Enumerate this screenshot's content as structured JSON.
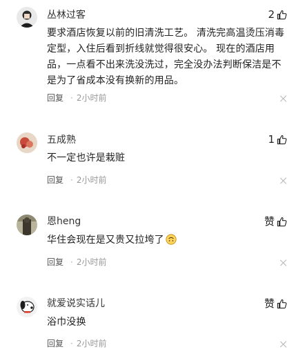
{
  "comments": [
    {
      "username": "丛林过客",
      "likes": "2",
      "text": "要求酒店恢复以前的旧清洗工艺。 清洗完高温烫压消毒定型，入住后看到折线就觉得很安心。 现在的酒店用品，一点看不出来洗没洗过，完全没办法判断保洁是不是为了省成本没有换新的用品。",
      "reply_label": "回复",
      "time": "2小时前"
    },
    {
      "username": "五成熟",
      "likes": "1",
      "text": "不一定也许是栽赃",
      "reply_label": "回复",
      "time": "2小时前"
    },
    {
      "username": "恩heng",
      "likes": "赞",
      "text": "华住会现在是又贵又拉垮了",
      "emoji": "upside-down-face-emoji",
      "reply_label": "回复",
      "time": "2小时前"
    },
    {
      "username": "就爱说实话儿",
      "likes": "赞",
      "text": "浴巾没换",
      "reply_label": "回复",
      "time": "2小时前"
    }
  ],
  "separator": "·",
  "icons": {
    "like": "thumbs-up-icon",
    "close": "close-icon"
  },
  "colors": {
    "text": "#222222",
    "meta": "#999999",
    "close": "#b5b5b5"
  }
}
